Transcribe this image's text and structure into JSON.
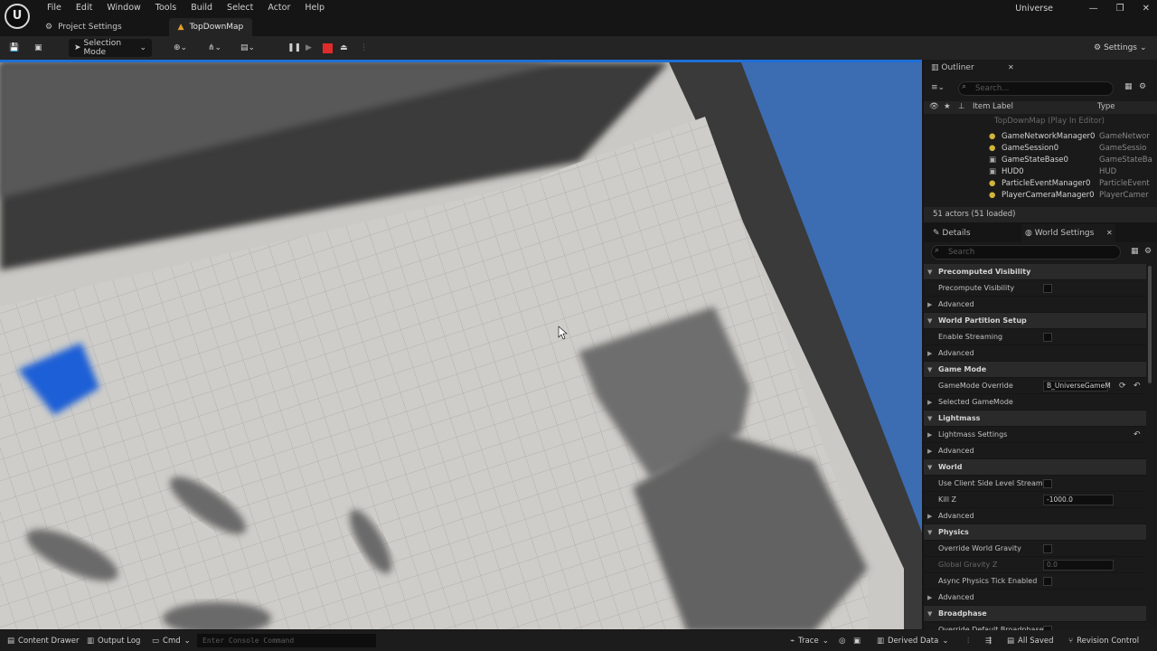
{
  "menu": [
    "File",
    "Edit",
    "Window",
    "Tools",
    "Build",
    "Select",
    "Actor",
    "Help"
  ],
  "tabs": {
    "project_settings": "Project Settings",
    "map": "TopDownMap"
  },
  "app_name": "Universe",
  "toolbar": {
    "selection_mode": "Selection Mode",
    "settings": "Settings"
  },
  "outliner": {
    "title": "Outliner",
    "search_placeholder": "Search...",
    "col_label": "Item Label",
    "col_type": "Type",
    "root": "TopDownMap (Play In Editor)",
    "items": [
      {
        "label": "GameNetworkManager0",
        "type": "GameNetwor"
      },
      {
        "label": "GameSession0",
        "type": "GameSessio"
      },
      {
        "label": "GameStateBase0",
        "type": "GameStateBa"
      },
      {
        "label": "HUD0",
        "type": "HUD"
      },
      {
        "label": "ParticleEventManager0",
        "type": "ParticleEvent"
      },
      {
        "label": "PlayerCameraManager0",
        "type": "PlayerCamer"
      }
    ],
    "count": "51 actors (51 loaded)"
  },
  "details": {
    "tab_details": "Details",
    "tab_world": "World Settings",
    "search_placeholder": "Search",
    "rows": [
      {
        "k": "cat",
        "label": "Precomputed Visibility"
      },
      {
        "k": "chk",
        "label": "Precompute Visibility"
      },
      {
        "k": "adv",
        "label": "Advanced"
      },
      {
        "k": "cat",
        "label": "World Partition Setup"
      },
      {
        "k": "chk",
        "label": "Enable Streaming"
      },
      {
        "k": "adv",
        "label": "Advanced"
      },
      {
        "k": "cat",
        "label": "Game Mode"
      },
      {
        "k": "sel",
        "label": "GameMode Override",
        "value": "B_UniverseGameM"
      },
      {
        "k": "adv",
        "label": "Selected GameMode"
      },
      {
        "k": "cat",
        "label": "Lightmass"
      },
      {
        "k": "adv",
        "label": "Lightmass Settings"
      },
      {
        "k": "adv",
        "label": "Advanced"
      },
      {
        "k": "cat",
        "label": "World"
      },
      {
        "k": "chk",
        "label": "Use Client Side Level Streami..."
      },
      {
        "k": "val",
        "label": "Kill Z",
        "value": "-1000.0"
      },
      {
        "k": "adv",
        "label": "Advanced"
      },
      {
        "k": "cat",
        "label": "Physics"
      },
      {
        "k": "chk",
        "label": "Override World Gravity"
      },
      {
        "k": "dval",
        "label": "Global Gravity Z",
        "value": "0.0"
      },
      {
        "k": "chk",
        "label": "Async Physics Tick Enabled"
      },
      {
        "k": "adv",
        "label": "Advanced"
      },
      {
        "k": "cat",
        "label": "Broadphase"
      },
      {
        "k": "chk",
        "label": "Override Default Broadphase..."
      }
    ]
  },
  "status": {
    "content_drawer": "Content Drawer",
    "output_log": "Output Log",
    "cmd": "Cmd",
    "console_placeholder": "Enter Console Command",
    "trace": "Trace",
    "derived_data": "Derived Data",
    "all_saved": "All Saved",
    "revision_control": "Revision Control"
  }
}
